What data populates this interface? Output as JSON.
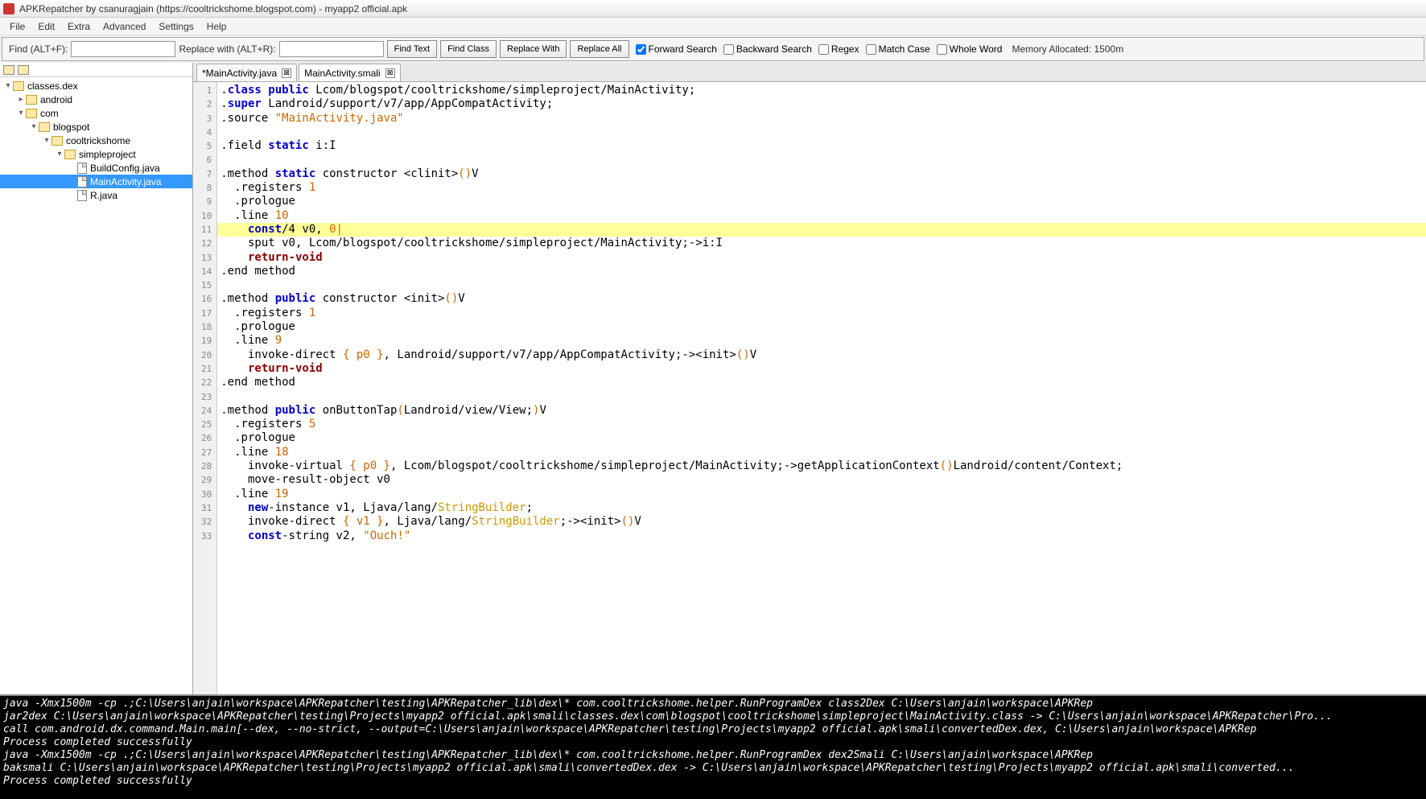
{
  "titlebar": {
    "title": "APKRepatcher by csanuragjain (https://cooltrickshome.blogspot.com) - myapp2 official.apk"
  },
  "menu": [
    "File",
    "Edit",
    "Extra",
    "Advanced",
    "Settings",
    "Help"
  ],
  "toolbar": {
    "find_label": "Find (ALT+F):",
    "find_value": "",
    "replace_label": "Replace with (ALT+R):",
    "replace_value": "",
    "find_text_btn": "Find Text",
    "find_class_btn": "Find Class",
    "replace_with_btn": "Replace With",
    "replace_all_btn": "Replace All",
    "forward_search": "Forward Search",
    "forward_search_checked": true,
    "backward_search": "Backward Search",
    "backward_search_checked": false,
    "regex": "Regex",
    "regex_checked": false,
    "match_case": "Match Case",
    "match_case_checked": false,
    "whole_word": "Whole Word",
    "whole_word_checked": false,
    "memory": "Memory Allocated: 1500m"
  },
  "tree": {
    "root": "classes.dex",
    "android": "android",
    "com": "com",
    "blogspot": "blogspot",
    "cooltrickshome": "cooltrickshome",
    "simpleproject": "simpleproject",
    "buildconfig": "BuildConfig.java",
    "mainactivity": "MainActivity.java",
    "r": "R.java"
  },
  "tabs": [
    {
      "label": "*MainActivity.java",
      "active": false
    },
    {
      "label": "MainActivity.smali",
      "active": true
    }
  ],
  "code": [
    {
      "n": 1,
      "hl": false,
      "tokens": [
        [
          ".",
          "dir"
        ],
        [
          "class ",
          "kw"
        ],
        [
          "public ",
          "kw"
        ],
        [
          "Lcom/blogspot/cooltrickshome/simpleproject/MainActivity;",
          "dir"
        ]
      ]
    },
    {
      "n": 2,
      "hl": false,
      "tokens": [
        [
          ".",
          "dir"
        ],
        [
          "super ",
          "kw"
        ],
        [
          "Landroid/support/v7/app/AppCompatActivity;",
          "dir"
        ]
      ]
    },
    {
      "n": 3,
      "hl": false,
      "tokens": [
        [
          ".source ",
          "dir"
        ],
        [
          "\"MainActivity.java\"",
          "str"
        ]
      ]
    },
    {
      "n": 4,
      "hl": false,
      "tokens": [
        [
          "",
          ""
        ]
      ]
    },
    {
      "n": 5,
      "hl": false,
      "tokens": [
        [
          ".field ",
          "dir"
        ],
        [
          "static ",
          "kw"
        ],
        [
          "i:I",
          "dir"
        ]
      ]
    },
    {
      "n": 6,
      "hl": false,
      "tokens": [
        [
          "",
          ""
        ]
      ]
    },
    {
      "n": 7,
      "hl": false,
      "tokens": [
        [
          ".method ",
          "dir"
        ],
        [
          "static ",
          "kw"
        ],
        [
          "constructor <clinit>",
          "dir"
        ],
        [
          "()",
          "num"
        ],
        [
          "V",
          "dir"
        ]
      ]
    },
    {
      "n": 8,
      "hl": false,
      "tokens": [
        [
          "  .registers ",
          "dir"
        ],
        [
          "1",
          "num"
        ]
      ]
    },
    {
      "n": 9,
      "hl": false,
      "tokens": [
        [
          "  .prologue",
          "dir"
        ]
      ]
    },
    {
      "n": 10,
      "hl": false,
      "tokens": [
        [
          "  .line ",
          "dir"
        ],
        [
          "10",
          "num"
        ]
      ]
    },
    {
      "n": 11,
      "hl": true,
      "tokens": [
        [
          "    ",
          "dir"
        ],
        [
          "const",
          "kw"
        ],
        [
          "/4 v0, ",
          "dir"
        ],
        [
          "0|",
          "num"
        ]
      ]
    },
    {
      "n": 12,
      "hl": false,
      "tokens": [
        [
          "    sput v0, Lcom/blogspot/cooltrickshome/simpleproject/MainActivity;->i:I",
          "dir"
        ]
      ]
    },
    {
      "n": 13,
      "hl": false,
      "tokens": [
        [
          "    ",
          "dir"
        ],
        [
          "return-void",
          "ret"
        ]
      ]
    },
    {
      "n": 14,
      "hl": false,
      "tokens": [
        [
          ".end method",
          "dir"
        ]
      ]
    },
    {
      "n": 15,
      "hl": false,
      "tokens": [
        [
          "",
          ""
        ]
      ]
    },
    {
      "n": 16,
      "hl": false,
      "tokens": [
        [
          ".method ",
          "dir"
        ],
        [
          "public ",
          "kw"
        ],
        [
          "constructor <init>",
          "dir"
        ],
        [
          "()",
          "num"
        ],
        [
          "V",
          "dir"
        ]
      ]
    },
    {
      "n": 17,
      "hl": false,
      "tokens": [
        [
          "  .registers ",
          "dir"
        ],
        [
          "1",
          "num"
        ]
      ]
    },
    {
      "n": 18,
      "hl": false,
      "tokens": [
        [
          "  .prologue",
          "dir"
        ]
      ]
    },
    {
      "n": 19,
      "hl": false,
      "tokens": [
        [
          "  .line ",
          "dir"
        ],
        [
          "9",
          "num"
        ]
      ]
    },
    {
      "n": 20,
      "hl": false,
      "tokens": [
        [
          "    invoke-direct ",
          "dir"
        ],
        [
          "{ p0 }",
          "num"
        ],
        [
          ", Landroid/support/v7/app/AppCompatActivity;-><init>",
          "dir"
        ],
        [
          "()",
          "num"
        ],
        [
          "V",
          "dir"
        ]
      ]
    },
    {
      "n": 21,
      "hl": false,
      "tokens": [
        [
          "    ",
          "dir"
        ],
        [
          "return-void",
          "ret"
        ]
      ]
    },
    {
      "n": 22,
      "hl": false,
      "tokens": [
        [
          ".end method",
          "dir"
        ]
      ]
    },
    {
      "n": 23,
      "hl": false,
      "tokens": [
        [
          "",
          ""
        ]
      ]
    },
    {
      "n": 24,
      "hl": false,
      "tokens": [
        [
          ".method ",
          "dir"
        ],
        [
          "public ",
          "kw"
        ],
        [
          "onButtonTap",
          "dir"
        ],
        [
          "(",
          "num"
        ],
        [
          "Landroid/view/View;",
          "dir"
        ],
        [
          ")",
          "num"
        ],
        [
          "V",
          "dir"
        ]
      ]
    },
    {
      "n": 25,
      "hl": false,
      "tokens": [
        [
          "  .registers ",
          "dir"
        ],
        [
          "5",
          "num"
        ]
      ]
    },
    {
      "n": 26,
      "hl": false,
      "tokens": [
        [
          "  .prologue",
          "dir"
        ]
      ]
    },
    {
      "n": 27,
      "hl": false,
      "tokens": [
        [
          "  .line ",
          "dir"
        ],
        [
          "18",
          "num"
        ]
      ]
    },
    {
      "n": 28,
      "hl": false,
      "tokens": [
        [
          "    invoke-virtual ",
          "dir"
        ],
        [
          "{ p0 }",
          "num"
        ],
        [
          ", Lcom/blogspot/cooltrickshome/simpleproject/MainActivity;->getApplicationContext",
          "dir"
        ],
        [
          "()",
          "num"
        ],
        [
          "Landroid/content/Context;",
          "dir"
        ]
      ]
    },
    {
      "n": 29,
      "hl": false,
      "tokens": [
        [
          "    move-result-object v0",
          "dir"
        ]
      ]
    },
    {
      "n": 30,
      "hl": false,
      "tokens": [
        [
          "  .line ",
          "dir"
        ],
        [
          "19",
          "num"
        ]
      ]
    },
    {
      "n": 31,
      "hl": false,
      "tokens": [
        [
          "    ",
          "dir"
        ],
        [
          "new",
          "kw"
        ],
        [
          "-instance v1, Ljava/lang/",
          "dir"
        ],
        [
          "StringBuilder",
          "type"
        ],
        [
          ";",
          "dir"
        ]
      ]
    },
    {
      "n": 32,
      "hl": false,
      "tokens": [
        [
          "    invoke-direct ",
          "dir"
        ],
        [
          "{ v1 }",
          "num"
        ],
        [
          ", Ljava/lang/",
          "dir"
        ],
        [
          "StringBuilder",
          "type"
        ],
        [
          ";-><init>",
          "dir"
        ],
        [
          "()",
          "num"
        ],
        [
          "V",
          "dir"
        ]
      ]
    },
    {
      "n": 33,
      "hl": false,
      "tokens": [
        [
          "    ",
          "dir"
        ],
        [
          "const",
          "kw"
        ],
        [
          "-string v2, ",
          "dir"
        ],
        [
          "\"Ouch!\"",
          "str"
        ]
      ]
    }
  ],
  "console": [
    "java -Xmx1500m -cp .;C:\\Users\\anjain\\workspace\\APKRepatcher\\testing\\APKRepatcher_lib\\dex\\* com.cooltrickshome.helper.RunProgramDex class2Dex C:\\Users\\anjain\\workspace\\APKRep",
    "jar2dex C:\\Users\\anjain\\workspace\\APKRepatcher\\testing\\Projects\\myapp2 official.apk\\smali\\classes.dex\\com\\blogspot\\cooltrickshome\\simpleproject\\MainActivity.class -> C:\\Users\\anjain\\workspace\\APKRepatcher\\Pro...",
    "call com.android.dx.command.Main.main[--dex, --no-strict, --output=C:\\Users\\anjain\\workspace\\APKRepatcher\\testing\\Projects\\myapp2 official.apk\\smali\\convertedDex.dex, C:\\Users\\anjain\\workspace\\APKRep",
    "Process completed successfully",
    "java -Xmx1500m -cp .;C:\\Users\\anjain\\workspace\\APKRepatcher\\testing\\APKRepatcher_lib\\dex\\* com.cooltrickshome.helper.RunProgramDex dex2Smali C:\\Users\\anjain\\workspace\\APKRep",
    "baksmali C:\\Users\\anjain\\workspace\\APKRepatcher\\testing\\Projects\\myapp2 official.apk\\smali\\convertedDex.dex -> C:\\Users\\anjain\\workspace\\APKRepatcher\\testing\\Projects\\myapp2 official.apk\\smali\\converted...",
    "Process completed successfully"
  ]
}
